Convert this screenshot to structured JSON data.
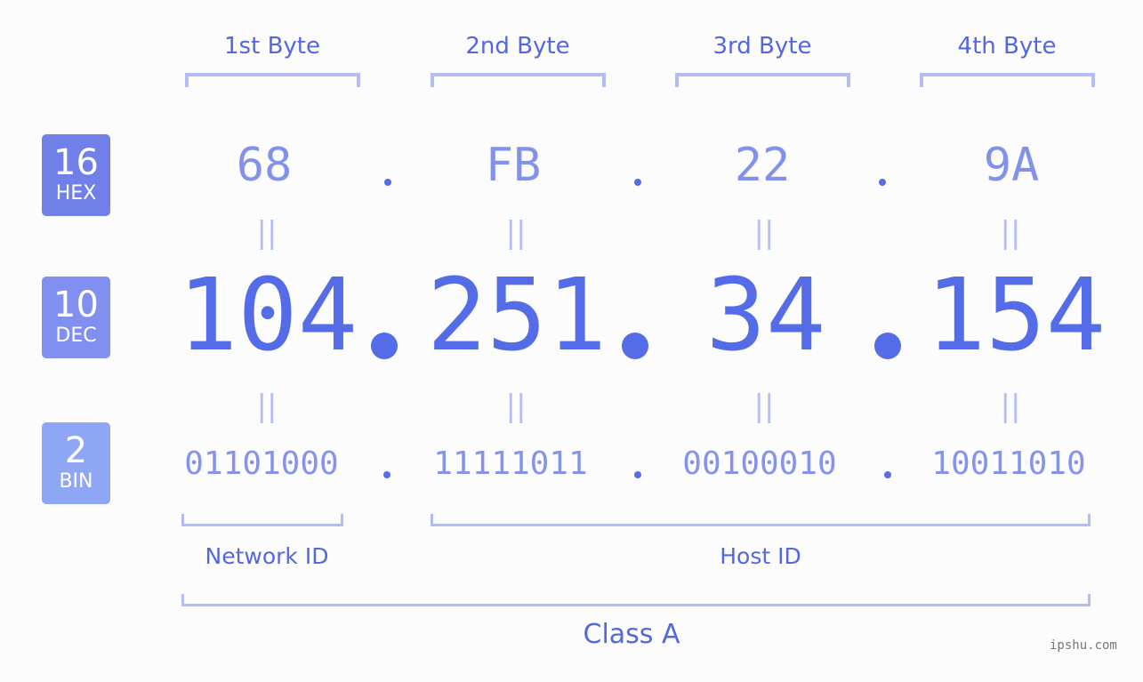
{
  "bases": [
    {
      "number": "16",
      "label": "HEX"
    },
    {
      "number": "10",
      "label": "DEC"
    },
    {
      "number": "2",
      "label": "BIN"
    }
  ],
  "byte_headers": [
    "1st Byte",
    "2nd Byte",
    "3rd Byte",
    "4th Byte"
  ],
  "hex": [
    "68",
    "FB",
    "22",
    "9A"
  ],
  "dec": [
    "104",
    "251",
    "34",
    "154"
  ],
  "bin": [
    "01101000",
    "11111011",
    "00100010",
    "10011010"
  ],
  "equals_glyph": "||",
  "segments": {
    "network": "Network ID",
    "host": "Host ID",
    "class": "Class A"
  },
  "colors": {
    "primary": "#556ce8",
    "bracket": "#b1bcf8",
    "hex_badge": "#7080e8",
    "dec_badge": "#8190f0",
    "bin_badge": "#8fa6f4"
  },
  "watermark": "ipshu.com"
}
